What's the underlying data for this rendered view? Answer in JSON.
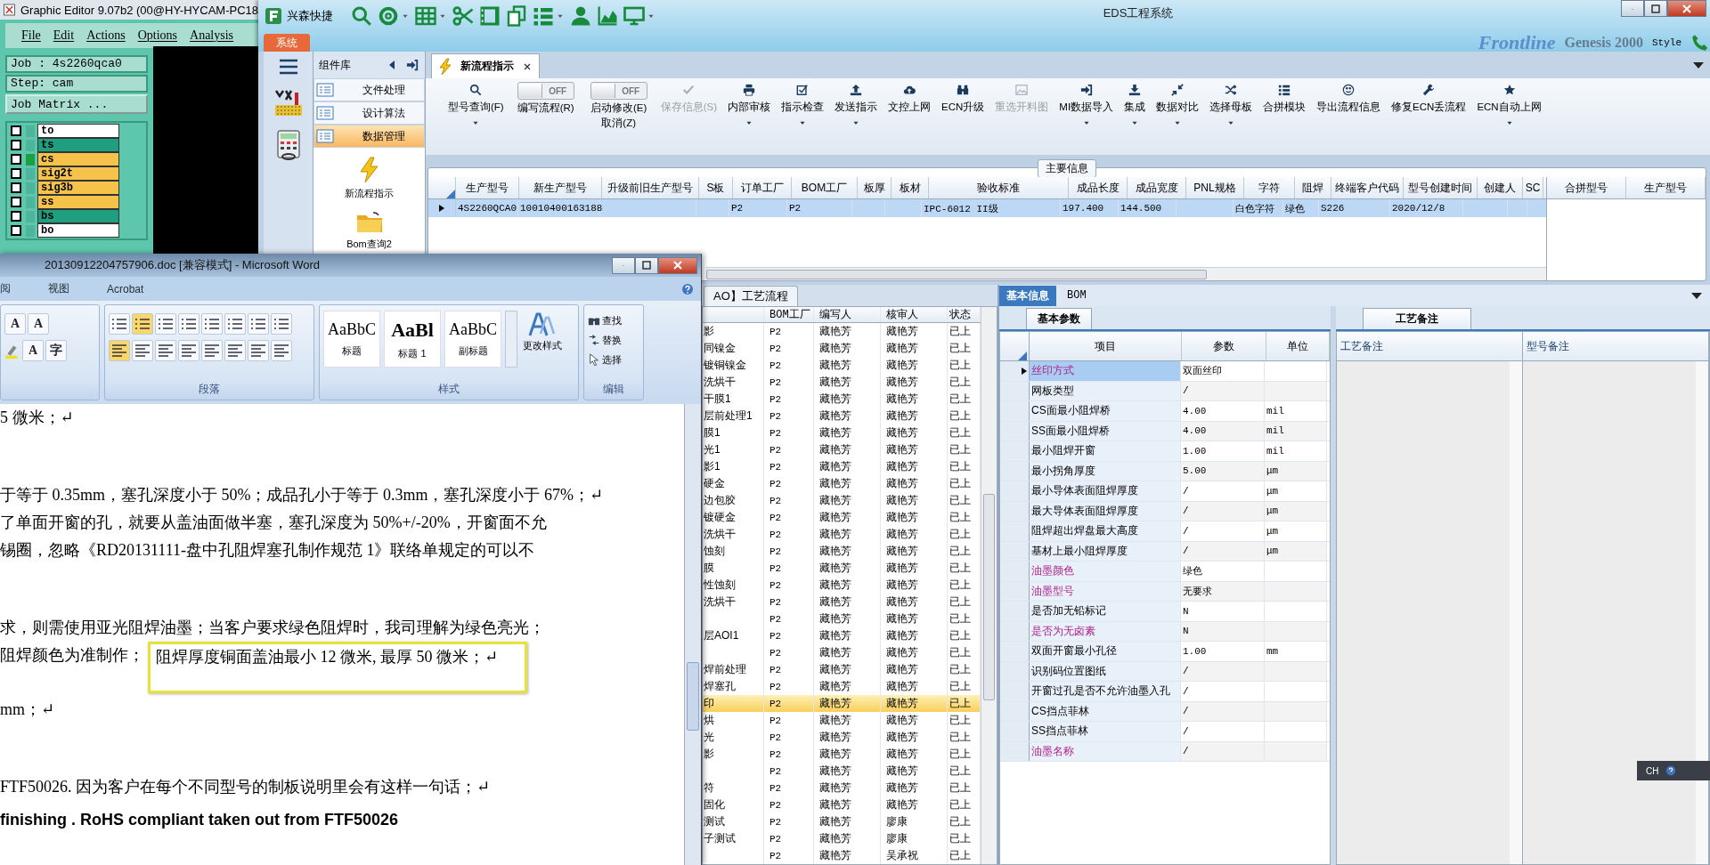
{
  "graphic_editor": {
    "title": "Graphic Editor 9.07b2 (00@HY-HYCAM-PC18",
    "menu": [
      "File",
      "Edit",
      "Actions",
      "Options",
      "Analysis"
    ],
    "job": "Job : 4s2260qca0",
    "step": "Step: cam",
    "job_matrix_button": "Job Matrix ...",
    "layers": [
      {
        "name": "to",
        "color": "#ffffff",
        "marked": false,
        "checked": false
      },
      {
        "name": "ts",
        "color": "#1f9e80",
        "marked": false,
        "checked": false
      },
      {
        "name": "cs",
        "color": "#f5c24a",
        "marked": true,
        "checked": false
      },
      {
        "name": "sig2t",
        "color": "#f5c24a",
        "marked": false,
        "checked": false
      },
      {
        "name": "sig3b",
        "color": "#f5c24a",
        "marked": false,
        "checked": false
      },
      {
        "name": "ss",
        "color": "#f5c24a",
        "marked": false,
        "checked": false
      },
      {
        "name": "bs",
        "color": "#1f9e80",
        "marked": false,
        "checked": false
      },
      {
        "name": "bo",
        "color": "#ffffff",
        "marked": false,
        "checked": false
      }
    ]
  },
  "eds": {
    "title": "EDS工程系统",
    "quick_label": "兴森快捷",
    "menu_tab": "系统",
    "background": {
      "logo": "Frontline",
      "product": "Genesis 2000",
      "style_menu": "Style"
    },
    "component_panel": {
      "title": "组件库",
      "groups": [
        {
          "label": "文件处理",
          "selected": false
        },
        {
          "label": "设计算法",
          "selected": false
        },
        {
          "label": "数据管理",
          "selected": true
        }
      ],
      "items": [
        {
          "label": "新流程指示",
          "kind": "lightning"
        },
        {
          "label": "Bom查询2",
          "kind": "folder"
        }
      ]
    },
    "tabs": [
      {
        "label": "新流程指示",
        "selected": true
      }
    ],
    "toolbar": [
      {
        "kind": "button",
        "label": "型号查询(F)",
        "caret": true,
        "disabled": false
      },
      {
        "kind": "toggle",
        "label": "编写流程(R)",
        "switch_text": "OFF",
        "on": false
      },
      {
        "kind": "toggle",
        "label": "启动修改(E)",
        "sub_label": "取消(Z)",
        "switch_text": "OFF",
        "on": false
      },
      {
        "kind": "button",
        "label": "保存信息(S)",
        "caret": false,
        "disabled": true
      },
      {
        "kind": "button",
        "label": "内部审核",
        "caret": true,
        "disabled": false
      },
      {
        "kind": "button",
        "label": "指示检查",
        "caret": true,
        "disabled": false
      },
      {
        "kind": "button",
        "label": "发送指示",
        "caret": true,
        "disabled": false
      },
      {
        "kind": "button",
        "label": "文控上网",
        "caret": false,
        "disabled": false
      },
      {
        "kind": "button",
        "label": "ECN升级",
        "caret": false,
        "disabled": false
      },
      {
        "kind": "button",
        "label": "重选开料图",
        "caret": false,
        "disabled": true
      },
      {
        "kind": "button",
        "label": "MI数据导入",
        "caret": true,
        "disabled": false
      },
      {
        "kind": "button",
        "label": "集成",
        "caret": true,
        "disabled": false
      },
      {
        "kind": "button",
        "label": "数据对比",
        "caret": true,
        "disabled": false
      },
      {
        "kind": "button",
        "label": "选择母板",
        "caret": true,
        "disabled": false
      },
      {
        "kind": "button",
        "label": "合拼模块",
        "caret": false,
        "disabled": false
      },
      {
        "kind": "button",
        "label": "导出流程信息",
        "caret": false,
        "disabled": false
      },
      {
        "kind": "button",
        "label": "修复ECN丢流程",
        "caret": false,
        "disabled": false
      },
      {
        "kind": "button",
        "label": "ECN自动上网",
        "caret": true,
        "disabled": false
      }
    ],
    "main_info": {
      "title": "主要信息",
      "columns": [
        "生产型号",
        "新生产型号",
        "升级前旧生产型号",
        "S板",
        "订单工厂",
        "BOM工厂",
        "板厚",
        "板材",
        "验收标准",
        "成品长度",
        "成品宽度",
        "PNL规格",
        "字符",
        "阻焊",
        "终端客户代码",
        "型号创建时间",
        "创建人",
        "SC"
      ],
      "rows": [
        {
          "selected": true,
          "cells": [
            "4S2260QCA0",
            "10010400163188",
            "",
            "",
            "P2",
            "P2",
            "",
            "",
            "IPC-6012 II级",
            "197.400",
            "144.500",
            "",
            "白色字符",
            "绿色",
            "S226",
            "2020/12/8",
            "",
            ""
          ]
        }
      ],
      "merge_columns": [
        "合拼型号",
        "生产型号"
      ]
    },
    "process_flow": {
      "tab": "AO】工艺流程",
      "columns": [
        "BOM工厂",
        "编写人",
        "核审人",
        "状态"
      ],
      "rows": [
        {
          "name": "影",
          "bom": "P2",
          "writer": "藏艳芳",
          "reviewer": "藏艳芳",
          "status": "已上",
          "selected": false
        },
        {
          "name": "同镍金",
          "bom": "P2",
          "writer": "藏艳芳",
          "reviewer": "藏艳芳",
          "status": "已上",
          "selected": false
        },
        {
          "name": "镀铜镍金",
          "bom": "P2",
          "writer": "藏艳芳",
          "reviewer": "藏艳芳",
          "status": "已上",
          "selected": false
        },
        {
          "name": "洗烘干",
          "bom": "P2",
          "writer": "藏艳芳",
          "reviewer": "藏艳芳",
          "status": "已上",
          "selected": false
        },
        {
          "name": "干膜1",
          "bom": "P2",
          "writer": "藏艳芳",
          "reviewer": "藏艳芳",
          "status": "已上",
          "selected": false
        },
        {
          "name": "层前处理1",
          "bom": "P2",
          "writer": "藏艳芳",
          "reviewer": "藏艳芳",
          "status": "已上",
          "selected": false
        },
        {
          "name": "膜1",
          "bom": "P2",
          "writer": "藏艳芳",
          "reviewer": "藏艳芳",
          "status": "已上",
          "selected": false
        },
        {
          "name": "光1",
          "bom": "P2",
          "writer": "藏艳芳",
          "reviewer": "藏艳芳",
          "status": "已上",
          "selected": false
        },
        {
          "name": "影1",
          "bom": "P2",
          "writer": "藏艳芳",
          "reviewer": "藏艳芳",
          "status": "已上",
          "selected": false
        },
        {
          "name": "硬金",
          "bom": "P2",
          "writer": "藏艳芳",
          "reviewer": "藏艳芳",
          "status": "已上",
          "selected": false
        },
        {
          "name": "边包胶",
          "bom": "P2",
          "writer": "藏艳芳",
          "reviewer": "藏艳芳",
          "status": "已上",
          "selected": false
        },
        {
          "name": "镀硬金",
          "bom": "P2",
          "writer": "藏艳芳",
          "reviewer": "藏艳芳",
          "status": "已上",
          "selected": false
        },
        {
          "name": "洗烘干",
          "bom": "P2",
          "writer": "藏艳芳",
          "reviewer": "藏艳芳",
          "status": "已上",
          "selected": false
        },
        {
          "name": "蚀刻",
          "bom": "P2",
          "writer": "藏艳芳",
          "reviewer": "藏艳芳",
          "status": "已上",
          "selected": false
        },
        {
          "name": "膜",
          "bom": "P2",
          "writer": "藏艳芳",
          "reviewer": "藏艳芳",
          "status": "已上",
          "selected": false
        },
        {
          "name": "性蚀刻",
          "bom": "P2",
          "writer": "藏艳芳",
          "reviewer": "藏艳芳",
          "status": "已上",
          "selected": false
        },
        {
          "name": "洗烘干",
          "bom": "P2",
          "writer": "藏艳芳",
          "reviewer": "藏艳芳",
          "status": "已上",
          "selected": false
        },
        {
          "bom": "P2",
          "writer": "藏艳芳",
          "reviewer": "藏艳芳",
          "status": "已上",
          "selected": false
        },
        {
          "name": "层AOI1",
          "bom": "P2",
          "writer": "藏艳芳",
          "reviewer": "藏艳芳",
          "status": "已上",
          "selected": false
        },
        {
          "bom": "P2",
          "writer": "藏艳芳",
          "reviewer": "藏艳芳",
          "status": "已上",
          "selected": false
        },
        {
          "name": "焊前处理",
          "bom": "P2",
          "writer": "藏艳芳",
          "reviewer": "藏艳芳",
          "status": "已上",
          "selected": false
        },
        {
          "name": "焊塞孔",
          "bom": "P2",
          "writer": "藏艳芳",
          "reviewer": "藏艳芳",
          "status": "已上",
          "selected": false
        },
        {
          "name": "印",
          "bom": "P2",
          "writer": "藏艳芳",
          "reviewer": "藏艳芳",
          "status": "已上",
          "selected": true
        },
        {
          "name": "烘",
          "bom": "P2",
          "writer": "藏艳芳",
          "reviewer": "藏艳芳",
          "status": "已上",
          "selected": false
        },
        {
          "name": "光",
          "bom": "P2",
          "writer": "藏艳芳",
          "reviewer": "藏艳芳",
          "status": "已上",
          "selected": false
        },
        {
          "name": "影",
          "bom": "P2",
          "writer": "藏艳芳",
          "reviewer": "藏艳芳",
          "status": "已上",
          "selected": false
        },
        {
          "bom": "P2",
          "writer": "藏艳芳",
          "reviewer": "藏艳芳",
          "status": "已上",
          "selected": false
        },
        {
          "name": "符",
          "bom": "P2",
          "writer": "藏艳芳",
          "reviewer": "藏艳芳",
          "status": "已上",
          "selected": false
        },
        {
          "name": "固化",
          "bom": "P2",
          "writer": "藏艳芳",
          "reviewer": "藏艳芳",
          "status": "已上",
          "selected": false
        },
        {
          "name": "测试",
          "bom": "P2",
          "writer": "藏艳芳",
          "reviewer": "廖康",
          "status": "已上",
          "selected": false
        },
        {
          "name": "子测试",
          "bom": "P2",
          "writer": "藏艳芳",
          "reviewer": "廖康",
          "status": "已上",
          "selected": false
        },
        {
          "bom": "P2",
          "writer": "藏艳芳",
          "reviewer": "吴承祝",
          "status": "已上",
          "selected": false
        }
      ]
    },
    "detail_tabs": [
      {
        "label": "基本信息",
        "selected": true
      },
      {
        "label": "BOM",
        "selected": false
      }
    ],
    "params": {
      "tab": "基本参数",
      "columns": [
        "项目",
        "参数",
        "单位"
      ],
      "rows": [
        {
          "item": "丝印方式",
          "value": "双面丝印",
          "unit": "",
          "emphasized": true,
          "selected": true
        },
        {
          "item": "网板类型",
          "value": "/",
          "unit": "",
          "emphasized": false,
          "selected": false
        },
        {
          "item": "CS面最小阻焊桥",
          "value": "4.00",
          "unit": "mil",
          "emphasized": false,
          "selected": false
        },
        {
          "item": "SS面最小阻焊桥",
          "value": "4.00",
          "unit": "mil",
          "emphasized": false,
          "selected": false
        },
        {
          "item": "最小阻焊开窗",
          "value": "1.00",
          "unit": "mil",
          "emphasized": false,
          "selected": false
        },
        {
          "item": "最小拐角厚度",
          "value": "5.00",
          "unit": "μm",
          "emphasized": false,
          "selected": false
        },
        {
          "item": "最小导体表面阻焊厚度",
          "value": "/",
          "unit": "μm",
          "emphasized": false,
          "selected": false
        },
        {
          "item": "最大导体表面阻焊厚度",
          "value": "/",
          "unit": "μm",
          "emphasized": false,
          "selected": false
        },
        {
          "item": "阻焊超出焊盘最大高度",
          "value": "/",
          "unit": "μm",
          "emphasized": false,
          "selected": false
        },
        {
          "item": "基材上最小阻焊厚度",
          "value": "/",
          "unit": "μm",
          "emphasized": false,
          "selected": false
        },
        {
          "item": "油墨颜色",
          "value": "绿色",
          "unit": "",
          "emphasized": true,
          "selected": false
        },
        {
          "item": "油墨型号",
          "value": "无要求",
          "unit": "",
          "emphasized": true,
          "selected": false
        },
        {
          "item": "是否加无铅标记",
          "value": "N",
          "unit": "",
          "emphasized": false,
          "selected": false
        },
        {
          "item": "是否为无卤素",
          "value": "N",
          "unit": "",
          "emphasized": true,
          "selected": false
        },
        {
          "item": "双面开窗最小孔径",
          "value": "1.00",
          "unit": "mm",
          "emphasized": false,
          "selected": false
        },
        {
          "item": "识别码位置图纸",
          "value": "/",
          "unit": "",
          "emphasized": false,
          "selected": false
        },
        {
          "item": "开窗过孔是否不允许油墨入孔",
          "value": "/",
          "unit": "",
          "emphasized": false,
          "selected": false
        },
        {
          "item": "CS挡点菲林",
          "value": "/",
          "unit": "",
          "emphasized": false,
          "selected": false
        },
        {
          "item": "SS挡点菲林",
          "value": "/",
          "unit": "",
          "emphasized": false,
          "selected": false
        },
        {
          "item": "油墨名称",
          "value": "/",
          "unit": "",
          "emphasized": true,
          "selected": false
        }
      ]
    },
    "notes": {
      "tab": "工艺备注",
      "columns": [
        "工艺备注",
        "型号备注"
      ]
    }
  },
  "word": {
    "title": "20130912204757906.doc [兼容模式] - Microsoft Word",
    "ribbon_tabs": [
      "阅",
      "视图",
      "Acrobat"
    ],
    "font_buttons": [
      "A",
      "A",
      "A",
      "字"
    ],
    "groups": [
      "段落",
      "样式",
      "编辑"
    ],
    "styles": [
      {
        "sample": "AaBbC",
        "name": "标题"
      },
      {
        "sample": "AaBl",
        "name": "标题 1"
      },
      {
        "sample": "AaBbC",
        "name": "副标题"
      }
    ],
    "change_styles": "更改样式",
    "editing": [
      "查找",
      "替换",
      "选择"
    ],
    "lines": [
      {
        "text": "5 微米；↵",
        "bold": false
      },
      {
        "text": "于等于 0.35mm，塞孔深度小于 50%；成品孔小于等于 0.3mm，塞孔深度小于 67%；↵",
        "bold": false
      },
      {
        "text": "了单面开窗的孔，就要从盖油面做半塞，塞孔深度为 50%+/-20%，开窗面不允",
        "bold": false
      },
      {
        "text": "锡圈，忽略《RD20131111-盘中孔阻焊塞孔制作规范  1》联络单规定的可以不",
        "bold": false
      },
      {
        "text": "求，则需使用亚光阻焊油墨；当客户要求绿色阻焊时，我司理解为绿色亮光；",
        "bold": false
      },
      {
        "text": "阻焊颜色为准制作；",
        "boxed_text": "阻焊厚度铜面盖油最小 12 微米, 最厚 50 微米；↵",
        "bold": false
      },
      {
        "text": "mm；↵",
        "bold": false
      },
      {
        "text": "FTF50026. 因为客户在每个不同型号的制板说明里会有这样一句话；↵",
        "bold": false
      },
      {
        "text": "finishing . RoHS compliant taken out from FTF50026",
        "bold": true
      }
    ]
  },
  "input_indicator": "CH"
}
